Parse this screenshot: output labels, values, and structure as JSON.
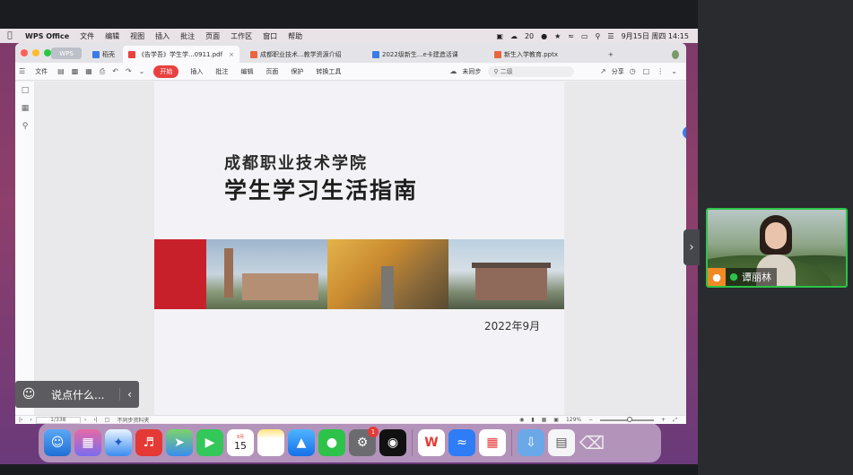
{
  "menubar": {
    "app_name": "WPS Office",
    "items": [
      "文件",
      "编辑",
      "视图",
      "插入",
      "批注",
      "页面",
      "工作区",
      "窗口",
      "帮助"
    ],
    "status": {
      "temp": "20",
      "datetime": "9月15日 周四  14:15"
    }
  },
  "wps": {
    "pill": "WPS",
    "tabs": [
      {
        "label": "稻壳"
      },
      {
        "label": "《告学吾》学生学...0911.pdf",
        "active": true
      },
      {
        "label": "成都职业技术...教学资源介绍"
      },
      {
        "label": "2022级新生...e卡建造活课"
      },
      {
        "label": "新生入学教育.pptx"
      }
    ],
    "toolbar": {
      "file": "文件",
      "start": "开始",
      "items": [
        "插入",
        "批注",
        "编辑",
        "页面",
        "保护",
        "转换工具"
      ],
      "cloud": "未同步",
      "search": "二级",
      "share": "分享"
    },
    "slide": {
      "title1": "成都职业技术学院",
      "title2": "学生学习生活指南",
      "date": "2022年9月"
    },
    "status": {
      "page": "1/338",
      "sync": "不同步资料夹",
      "zoom": "129%"
    }
  },
  "chat_pill": {
    "placeholder": "说点什么..."
  },
  "participant": {
    "name": "谭丽林"
  },
  "dock": {
    "wps_label": "W",
    "badge_count": "1"
  }
}
